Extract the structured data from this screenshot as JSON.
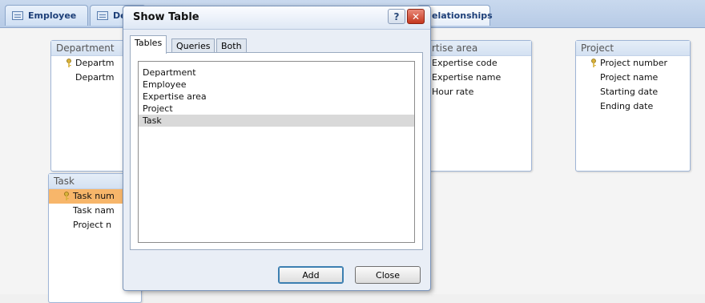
{
  "tabs": [
    {
      "label": "Employee"
    },
    {
      "label": "De"
    },
    {
      "label": "elationships"
    }
  ],
  "tables": {
    "department": {
      "title": "Department",
      "fields": [
        "Departm",
        "Departm"
      ]
    },
    "expertise": {
      "title": "rtise area",
      "fields": [
        "Expertise code",
        "Expertise name",
        "Hour rate"
      ]
    },
    "project": {
      "title": "Project",
      "fields": [
        "Project number",
        "Project name",
        "Starting date",
        "Ending date"
      ]
    },
    "task": {
      "title": "Task",
      "fields": [
        "Task num",
        "Task nam",
        "Project n"
      ]
    }
  },
  "dialog": {
    "title": "Show Table",
    "help_glyph": "?",
    "close_glyph": "✕",
    "tabs": [
      "Tables",
      "Queries",
      "Both"
    ],
    "active_tab": "Tables",
    "list_items": [
      "Department",
      "Employee",
      "Expertise area",
      "Project",
      "Task"
    ],
    "selected_item": "Task",
    "add_label": "Add",
    "close_label": "Close"
  },
  "colors": {
    "accent": "#3c7fb1",
    "selected_field": "#f7b66a",
    "key_icon": "#d9b23a",
    "close_button": "#c5371e"
  }
}
